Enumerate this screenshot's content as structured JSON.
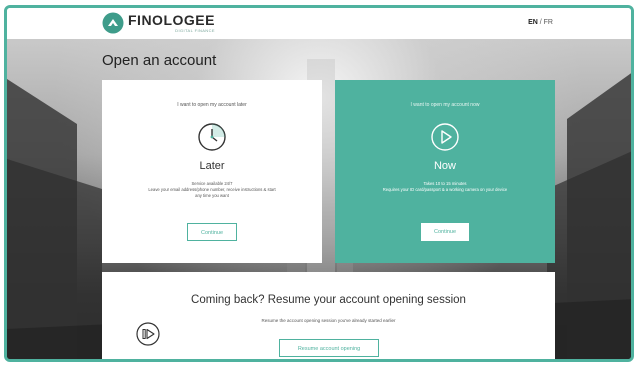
{
  "header": {
    "brand": "FINOLOGEE",
    "tagline": "DIGITAL FINANCE",
    "lang_en": "EN",
    "lang_sep": " / ",
    "lang_fr": "FR"
  },
  "page": {
    "title": "Open an account"
  },
  "cards": {
    "later": {
      "heading": "I want to open my account later",
      "icon": "clock-icon",
      "title": "Later",
      "line1": "Service available 24/7",
      "line2": "Leave your email address/phone number, receive instructions & start",
      "line3": "any time you want",
      "button": "Continue"
    },
    "now": {
      "heading": "I want to open my account now",
      "icon": "play-icon",
      "title": "Now",
      "line1": "Takes 10 to 15 minutes",
      "line2": "Requires your ID card/passport & a working camera on your device",
      "button": "Continue"
    }
  },
  "resume": {
    "title": "Coming back? Resume your account opening session",
    "subtitle": "Resume the account opening session you've already started earlier",
    "icon": "resume-icon",
    "button": "Resume account opening"
  },
  "colors": {
    "accent": "#4fb29f",
    "text": "#333333"
  }
}
